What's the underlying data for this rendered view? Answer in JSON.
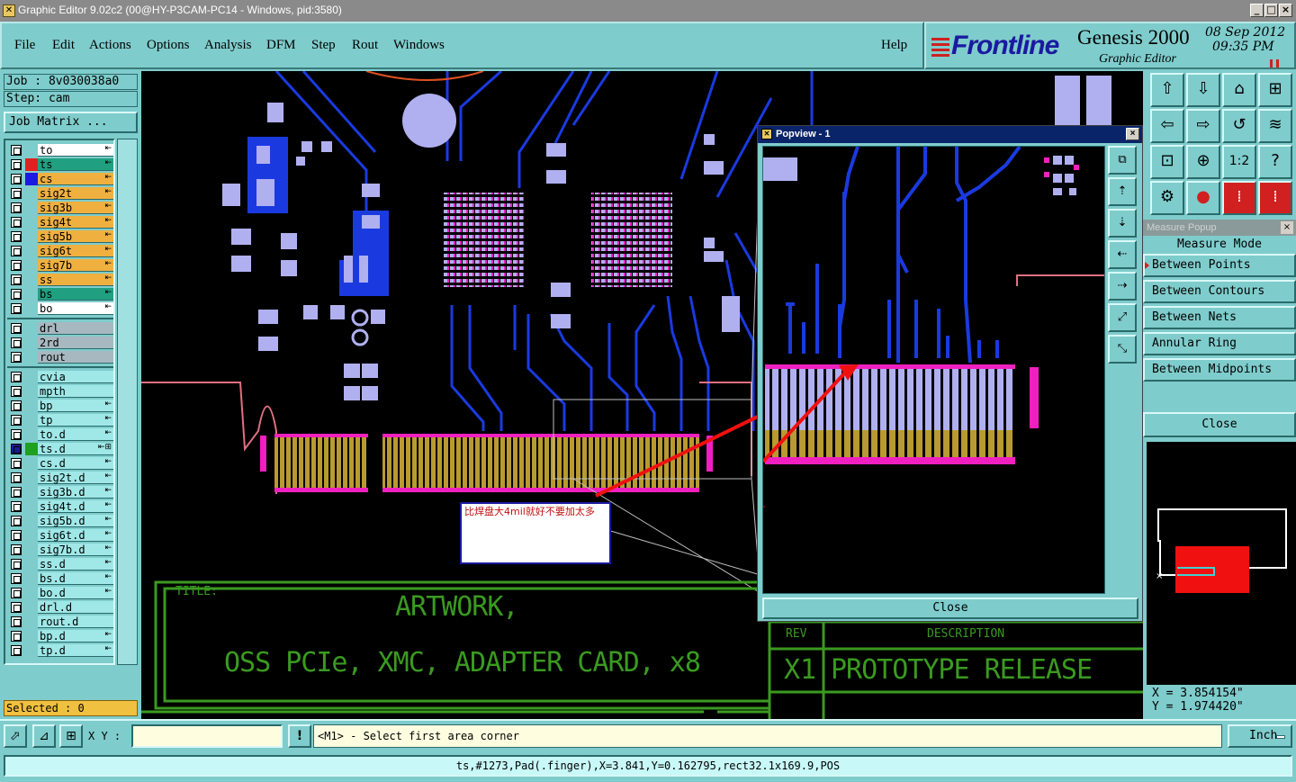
{
  "window": {
    "title": "Graphic Editor 9.02c2 (00@HY-P3CAM-PC14 - Windows, pid:3580)",
    "controls": [
      "_",
      "□",
      "×"
    ]
  },
  "menu": {
    "items": [
      "File",
      "Edit",
      "Actions",
      "Options",
      "Analysis",
      "DFM",
      "Step",
      "Rout",
      "Windows"
    ],
    "help": "Help"
  },
  "brand": {
    "logo": "Frontline",
    "product": "Genesis 2000",
    "subtitle": "Graphic Editor",
    "date": "08 Sep 2012",
    "time": "09:35 PM"
  },
  "job": {
    "job_line": "Job : 8v030038a0",
    "step_line": "Step: cam",
    "matrix_button": "Job Matrix ..."
  },
  "layers": [
    {
      "name": "to",
      "swatch": "",
      "bg": "#ffffff",
      "flag": "⇤"
    },
    {
      "name": "ts",
      "swatch": "#e02020",
      "bg": "#20a080",
      "flag": "⇤"
    },
    {
      "name": "cs",
      "swatch": "#1a1ae0",
      "bg": "#f0b040",
      "flag": "⇤"
    },
    {
      "name": "sig2t",
      "swatch": "",
      "bg": "#f0b040",
      "flag": "⇤"
    },
    {
      "name": "sig3b",
      "swatch": "",
      "bg": "#f0b040",
      "flag": "⇤"
    },
    {
      "name": "sig4t",
      "swatch": "",
      "bg": "#f0b040",
      "flag": "⇤"
    },
    {
      "name": "sig5b",
      "swatch": "",
      "bg": "#f0b040",
      "flag": "⇤"
    },
    {
      "name": "sig6t",
      "swatch": "",
      "bg": "#f0b040",
      "flag": "⇤"
    },
    {
      "name": "sig7b",
      "swatch": "",
      "bg": "#f0b040",
      "flag": "⇤"
    },
    {
      "name": "ss",
      "swatch": "",
      "bg": "#f0b040",
      "flag": "⇤"
    },
    {
      "name": "bs",
      "swatch": "",
      "bg": "#20a080",
      "flag": "⇤"
    },
    {
      "name": "bo",
      "swatch": "",
      "bg": "#ffffff",
      "flag": "⇤"
    },
    {
      "name": "drl",
      "swatch": "",
      "bg": "#a8b8c0",
      "flag": ""
    },
    {
      "name": "2rd",
      "swatch": "",
      "bg": "#a8b8c0",
      "flag": ""
    },
    {
      "name": "rout",
      "swatch": "",
      "bg": "#a8b8c0",
      "flag": ""
    },
    {
      "name": "cvia",
      "swatch": "",
      "bg": "#a0e8e8",
      "flag": ""
    },
    {
      "name": "mpth",
      "swatch": "",
      "bg": "#a0e8e8",
      "flag": ""
    },
    {
      "name": "bp",
      "swatch": "",
      "bg": "#a0e8e8",
      "flag": "⇤"
    },
    {
      "name": "tp",
      "swatch": "",
      "bg": "#a0e8e8",
      "flag": "⇤"
    },
    {
      "name": "to.d",
      "swatch": "",
      "bg": "#a0e8e8",
      "flag": "⇤"
    },
    {
      "name": "ts.d",
      "swatch": "#20a020",
      "bg": "#a0e8e8",
      "flag": "⇤⊞"
    },
    {
      "name": "cs.d",
      "swatch": "",
      "bg": "#a0e8e8",
      "flag": "⇤"
    },
    {
      "name": "sig2t.d",
      "swatch": "",
      "bg": "#a0e8e8",
      "flag": "⇤"
    },
    {
      "name": "sig3b.d",
      "swatch": "",
      "bg": "#a0e8e8",
      "flag": "⇤"
    },
    {
      "name": "sig4t.d",
      "swatch": "",
      "bg": "#a0e8e8",
      "flag": "⇤"
    },
    {
      "name": "sig5b.d",
      "swatch": "",
      "bg": "#a0e8e8",
      "flag": "⇤"
    },
    {
      "name": "sig6t.d",
      "swatch": "",
      "bg": "#a0e8e8",
      "flag": "⇤"
    },
    {
      "name": "sig7b.d",
      "swatch": "",
      "bg": "#a0e8e8",
      "flag": "⇤"
    },
    {
      "name": "ss.d",
      "swatch": "",
      "bg": "#a0e8e8",
      "flag": "⇤"
    },
    {
      "name": "bs.d",
      "swatch": "",
      "bg": "#a0e8e8",
      "flag": "⇤"
    },
    {
      "name": "bo.d",
      "swatch": "",
      "bg": "#a0e8e8",
      "flag": "⇤"
    },
    {
      "name": "drl.d",
      "swatch": "",
      "bg": "#a0e8e8",
      "flag": ""
    },
    {
      "name": "rout.d",
      "swatch": "",
      "bg": "#a0e8e8",
      "flag": ""
    },
    {
      "name": "bp.d",
      "swatch": "",
      "bg": "#a0e8e8",
      "flag": "⇤"
    },
    {
      "name": "tp.d",
      "swatch": "",
      "bg": "#a0e8e8",
      "flag": "⇤"
    }
  ],
  "selected": "Selected : 0",
  "canvas": {
    "title_label": "TITLE:",
    "title_line1": "ARTWORK,",
    "title_line2": "OSS PCIe, XMC, ADAPTER CARD, x8",
    "rev_label": "REV",
    "desc_label": "DESCRIPTION",
    "rev_value": "X1",
    "desc_value": "PROTOTYPE RELEASE",
    "note": "比焊盘大4mil就好不要加太多"
  },
  "popview": {
    "title": "Popview - 1",
    "close": "Close"
  },
  "measure": {
    "title": "Measure Popup",
    "heading": "Measure Mode",
    "options": [
      "Between Points",
      "Between Contours",
      "Between Nets",
      "Annular Ring",
      "Between Midpoints"
    ],
    "close": "Close"
  },
  "coords": {
    "x": "X = 3.854154\"",
    "y": "Y = 1.974420\""
  },
  "command": {
    "xy_label": "X Y :",
    "xy_value": "",
    "prompt": "<M1> - Select first area corner",
    "unit": "Inch"
  },
  "status": "ts,#1273,Pad(.finger),X=3.841,Y=0.162795,rect32.1x169.9,POS",
  "colors": {
    "panel": "#7fcccc",
    "pad_blue": "#b0b0f0",
    "trace_blue": "#1a3ae0",
    "gold": "#b89a30",
    "silk_green": "#3a9a20",
    "magenta": "#f020c0"
  }
}
